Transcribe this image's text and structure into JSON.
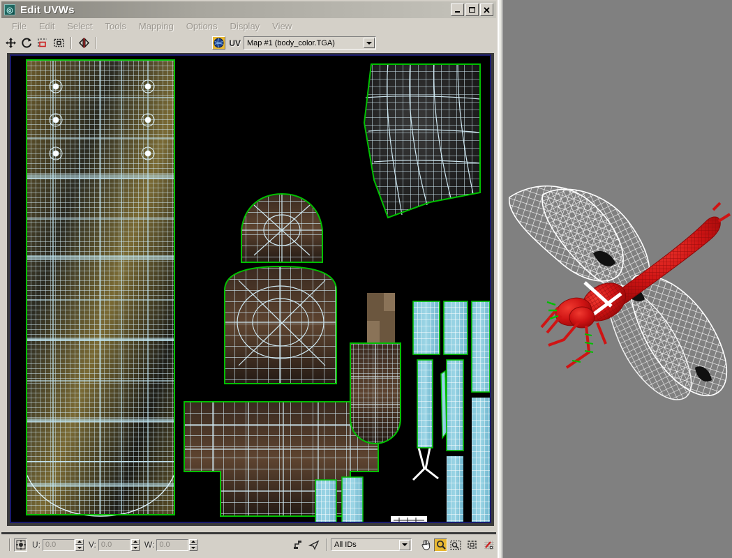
{
  "window": {
    "title": "Edit UVWs",
    "app_icon": "max-uvw-icon",
    "controls": {
      "minimize": "_",
      "maximize": "□",
      "close": "✕"
    }
  },
  "menubar": {
    "items": [
      {
        "label": "File",
        "name": "menu-file"
      },
      {
        "label": "Edit",
        "name": "menu-edit"
      },
      {
        "label": "Select",
        "name": "menu-select"
      },
      {
        "label": "Tools",
        "name": "menu-tools"
      },
      {
        "label": "Mapping",
        "name": "menu-mapping"
      },
      {
        "label": "Options",
        "name": "menu-options"
      },
      {
        "label": "Display",
        "name": "menu-display"
      },
      {
        "label": "View",
        "name": "menu-view"
      }
    ]
  },
  "toolbar": {
    "tools": [
      {
        "name": "move-tool-icon",
        "title": "Move"
      },
      {
        "name": "rotate-tool-icon",
        "title": "Rotate"
      },
      {
        "name": "scale-tool-icon",
        "title": "Scale"
      },
      {
        "name": "freeform-mode-icon",
        "title": "Freeform Mode"
      },
      {
        "name": "mirror-tool-icon",
        "title": "Mirror"
      }
    ],
    "uv_badge_label": "UV",
    "map_selector": {
      "value": "Map #1 (body_color.TGA)",
      "placeholder": "Map #1 (body_color.TGA)"
    }
  },
  "statusbar": {
    "pivot_button": "center-pivot-icon",
    "coords": [
      {
        "label": "U:",
        "value": "0.0",
        "name": "u-spinner"
      },
      {
        "label": "V:",
        "value": "0.0",
        "name": "v-spinner"
      },
      {
        "label": "W:",
        "value": "0.0",
        "name": "w-spinner"
      }
    ],
    "lock_icon": "lock-selection-icon",
    "filter_icon": "filter-selected-faces-icon",
    "material_ids": {
      "value": "All IDs"
    },
    "view_tools": [
      {
        "name": "pan-view-icon",
        "title": "Pan",
        "active": false
      },
      {
        "name": "zoom-view-icon",
        "title": "Zoom",
        "active": true
      },
      {
        "name": "zoom-region-icon",
        "title": "Zoom Region",
        "active": false
      },
      {
        "name": "zoom-extents-icon",
        "title": "Zoom Extents",
        "active": false
      },
      {
        "name": "snap-toggle-icon",
        "title": "Snap",
        "active": false
      }
    ]
  },
  "canvas": {
    "name": "uv-edit-canvas",
    "background_color": "#000000",
    "border_color": "#1a1a6e",
    "edge_color": "#00c000",
    "wire_color": "#cfe8f2",
    "vertex_color": "#ffffff"
  },
  "viewport": {
    "name": "perspective-viewport",
    "background_color": "#808080",
    "model_name": "dragonfly-model",
    "selection_color": "#dd1111",
    "wire_color": "#ffffff",
    "gizmo_color": "#00c000"
  }
}
